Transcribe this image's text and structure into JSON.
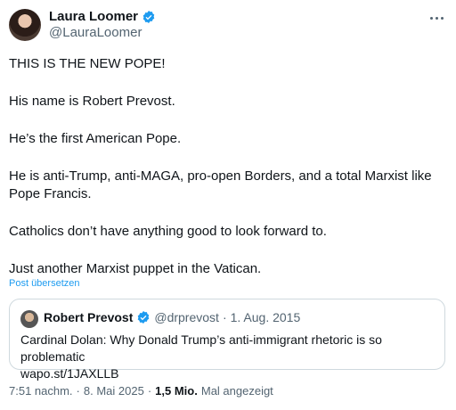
{
  "author": {
    "name": "Laura Loomer",
    "handle": "@LauraLoomer"
  },
  "post": {
    "paragraphs": [
      "THIS IS THE NEW POPE!",
      "His name is Robert Prevost.",
      "He’s the first American Pope.",
      "He is anti-Trump, anti-MAGA, pro-open Borders, and a total Marxist like Pope Francis.",
      "Catholics don’t have anything good to look forward to.",
      "Just another Marxist puppet in the Vatican."
    ],
    "translate_label": "Post übersetzen"
  },
  "quote": {
    "name": "Robert Prevost",
    "handle": "@drprevost",
    "date": "1. Aug. 2015",
    "text": "Cardinal Dolan: Why Donald Trump’s anti-immigrant rhetoric is so problematic",
    "link": "wapo.st/1JAXLLB"
  },
  "footer": {
    "time": "7:51 nachm.",
    "date": "8. Mai 2025",
    "views_count": "1,5 Mio.",
    "views_label": "Mal angezeigt"
  },
  "colors": {
    "accent": "#1d9bf0",
    "muted": "#536471",
    "border": "#cfd9de"
  }
}
